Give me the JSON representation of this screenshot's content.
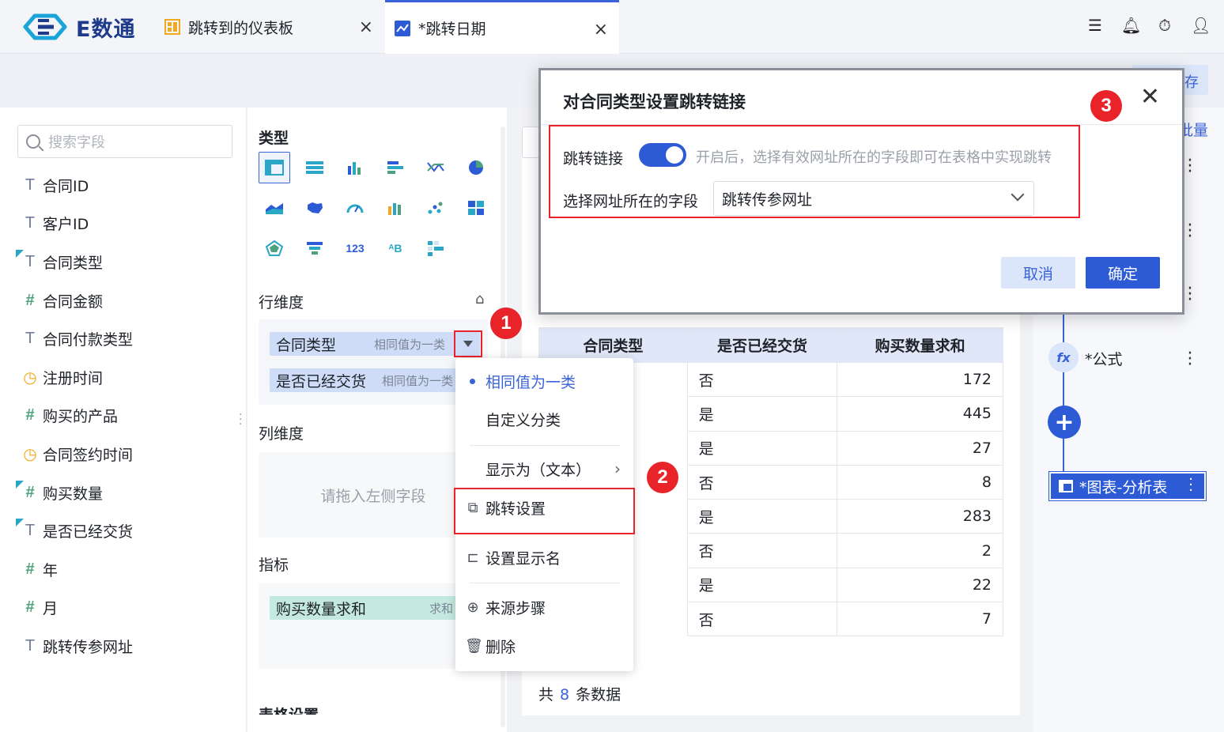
{
  "app": {
    "brand": "E数通"
  },
  "tabs": [
    {
      "label": "跳转到的仪表板",
      "close": "×"
    },
    {
      "label": "*跳转日期",
      "close": "×"
    }
  ],
  "toolbar": {
    "save_label": "存"
  },
  "search": {
    "placeholder": "搜索字段"
  },
  "fields": [
    {
      "icon": "T",
      "label": "合同ID"
    },
    {
      "icon": "T",
      "label": "客户ID"
    },
    {
      "icon": "T",
      "label": "合同类型"
    },
    {
      "icon": "#",
      "label": "合同金额"
    },
    {
      "icon": "T",
      "label": "合同付款类型"
    },
    {
      "icon": "clock",
      "label": "注册时间"
    },
    {
      "icon": "#",
      "label": "购买的产品"
    },
    {
      "icon": "clock",
      "label": "合同签约时间"
    },
    {
      "icon": "#",
      "label": "购买数量"
    },
    {
      "icon": "T",
      "label": "是否已经交货"
    },
    {
      "icon": "#",
      "label": "年"
    },
    {
      "icon": "#",
      "label": "月"
    },
    {
      "icon": "T",
      "label": "跳转传参网址"
    }
  ],
  "config": {
    "type_title": "类型",
    "row_dim_title": "行维度",
    "col_dim_title": "列维度",
    "indicator_title": "指标",
    "table_settings_title": "表格设置",
    "row_pills": [
      {
        "label": "合同类型",
        "sub": "相同值为一类"
      },
      {
        "label": "是否已经交货",
        "sub": "相同值为一类"
      }
    ],
    "col_placeholder": "请拖入左侧字段",
    "indicator_pill": {
      "label": "购买数量求和",
      "sub": "求和"
    }
  },
  "menu": {
    "items": [
      "相同值为一类",
      "自定义分类",
      "显示为（文本）",
      "跳转设置",
      "设置显示名",
      "来源步骤",
      "删除"
    ]
  },
  "table": {
    "headers": [
      "合同类型",
      "是否已经交货",
      "购买数量求和"
    ],
    "rows": [
      [
        "",
        "否",
        "172"
      ],
      [
        "",
        "是",
        "445"
      ],
      [
        "",
        "是",
        "27"
      ],
      [
        "",
        "否",
        "8"
      ],
      [
        "",
        "是",
        "283"
      ],
      [
        "",
        "否",
        "2"
      ],
      [
        "",
        "是",
        "22"
      ],
      [
        "",
        "否",
        "7"
      ]
    ],
    "total_prefix": "共",
    "total_count": "8",
    "total_suffix": "条数据"
  },
  "flow": {
    "fx_label": "*公式",
    "chart_label": "*图表-分析表",
    "top_label": "批量"
  },
  "modal": {
    "title": "对合同类型设置跳转链接",
    "jump_label": "跳转链接",
    "jump_hint": "开启后，选择有效网址所在的字段即可在表格中实现跳转",
    "field_label": "选择网址所在的字段",
    "field_value": "跳转传参网址",
    "cancel": "取消",
    "confirm": "确定",
    "toggle_on": true
  },
  "badges": [
    "1",
    "2",
    "3"
  ],
  "colors": {
    "accent": "#2d5bd6",
    "highlight": "#e8232a"
  }
}
